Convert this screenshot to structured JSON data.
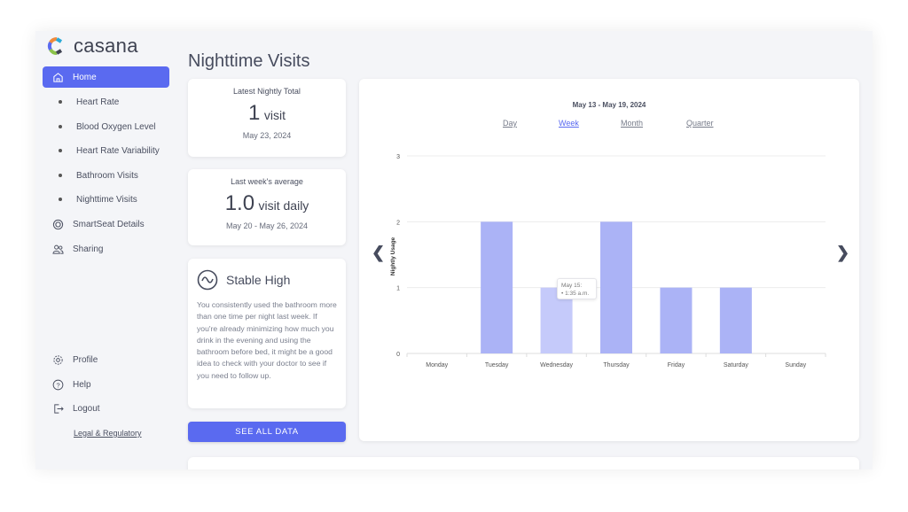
{
  "app": {
    "brand": "casana",
    "page_title": "Nighttime Visits"
  },
  "sidebar": {
    "items": [
      {
        "label": "Home",
        "icon": "home-icon",
        "active": true
      },
      {
        "label": "Heart Rate",
        "icon": "bullet"
      },
      {
        "label": "Blood Oxygen Level",
        "icon": "bullet"
      },
      {
        "label": "Heart Rate Variability",
        "icon": "bullet"
      },
      {
        "label": "Bathroom Visits",
        "icon": "bullet"
      },
      {
        "label": "Nighttime Visits",
        "icon": "bullet"
      },
      {
        "label": "SmartSeat Details",
        "icon": "seat-icon"
      },
      {
        "label": "Sharing",
        "icon": "users-icon"
      }
    ],
    "bottom": [
      {
        "label": "Profile",
        "icon": "gear-icon"
      },
      {
        "label": "Help",
        "icon": "help-icon"
      },
      {
        "label": "Logout",
        "icon": "logout-icon"
      }
    ],
    "legal": "Legal & Regulatory"
  },
  "latest": {
    "label": "Latest Nightly Total",
    "value": "1",
    "unit": "visit",
    "date": "May 23, 2024"
  },
  "average": {
    "label": "Last week's average",
    "value": "1.0",
    "unit": "visit daily",
    "date": "May 20 - May 26, 2024"
  },
  "insight": {
    "title": "Stable High",
    "icon": "wave-icon",
    "text": "You consistently used the bathroom more than one time per night last week. If you're already minimizing how much you drink in the evening and using the bathroom before bed, it might be a good idea to check with your doctor to see if you need to follow up."
  },
  "see_all": "SEE ALL DATA",
  "chart_tabs": [
    "Day",
    "Week",
    "Month",
    "Quarter"
  ],
  "chart_tab_selected": "Week",
  "tooltip": {
    "title": "May 15:",
    "item": "1:35 a.m."
  },
  "colors": {
    "accent": "#5a6af0",
    "bar": "#abb3f6",
    "bar_hover": "#c5cafa"
  },
  "chart_data": {
    "type": "bar",
    "title": "May 13 - May 19, 2024",
    "ylabel": "Nightly Usage",
    "xlabel": "",
    "categories": [
      "Monday",
      "Tuesday",
      "Wednesday",
      "Thursday",
      "Friday",
      "Saturday",
      "Sunday"
    ],
    "values": [
      0,
      2,
      1,
      2,
      1,
      1,
      0
    ],
    "ylim": [
      0,
      3
    ],
    "yticks": [
      "0",
      "1",
      "2",
      "3"
    ],
    "grid": true,
    "highlighted": "Wednesday"
  }
}
